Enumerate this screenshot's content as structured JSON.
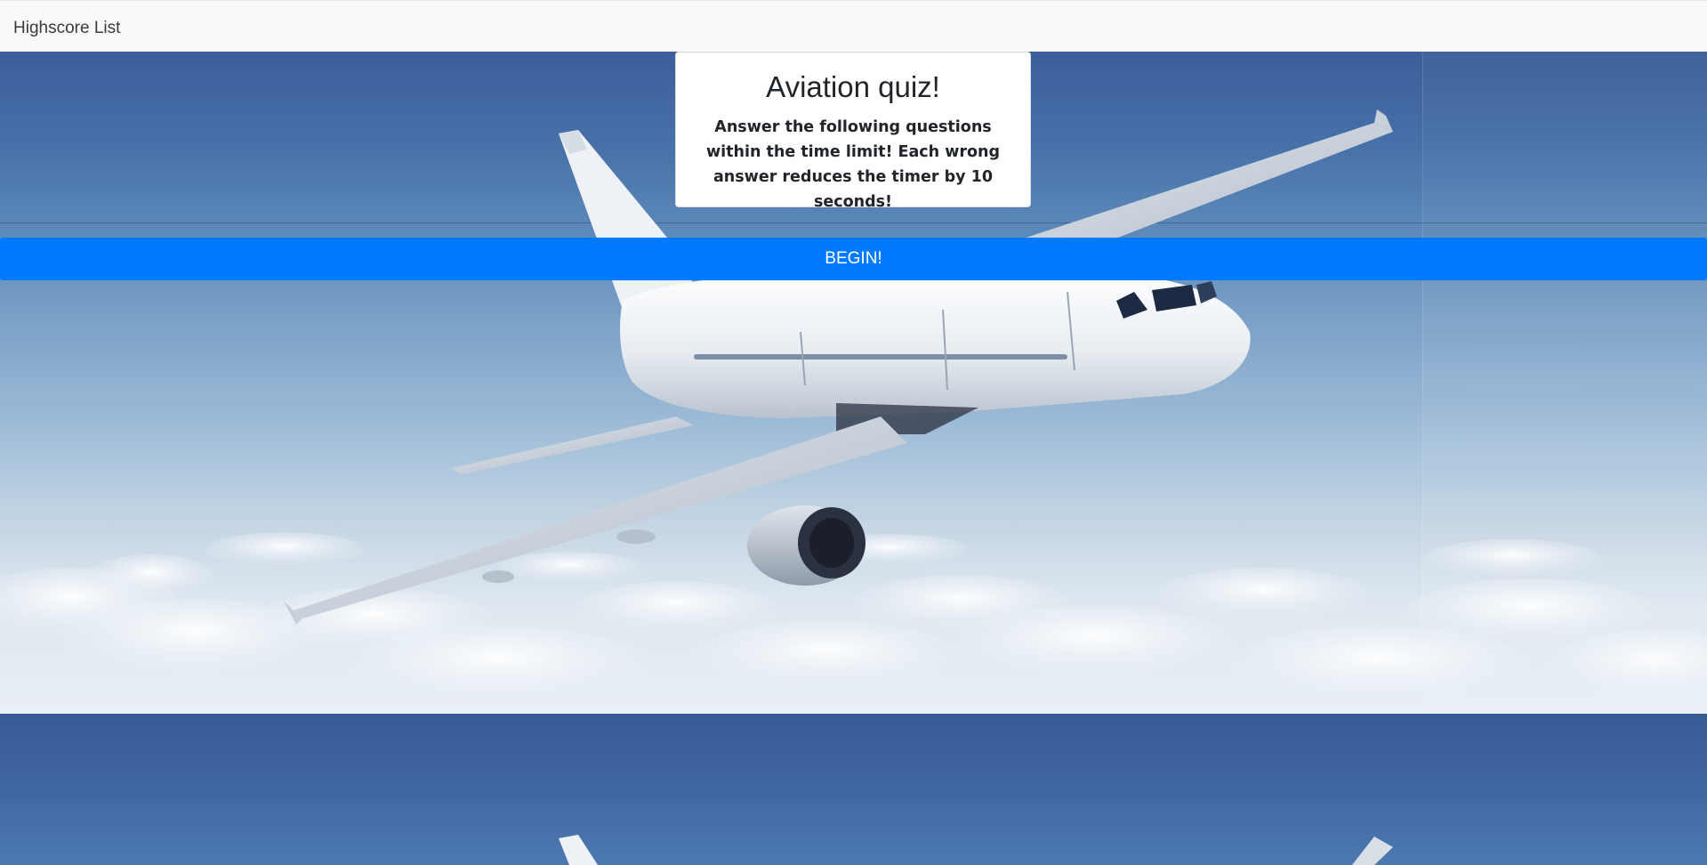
{
  "nav": {
    "highscore_link": "Highscore List"
  },
  "card": {
    "title": "Aviation quiz!",
    "description": "Answer the following questions within the time limit! Each wrong answer reduces the timer by 10 seconds!"
  },
  "begin_button": {
    "label": "BEGIN!"
  },
  "colors": {
    "button_primary": "#007bff",
    "navbar_bg": "#f8f9fa",
    "card_bg": "#ffffff",
    "sky_top": "#3d5f99",
    "sky_bottom": "#e9eff5"
  },
  "background": {
    "image_subject": "airplane-over-clouds"
  }
}
